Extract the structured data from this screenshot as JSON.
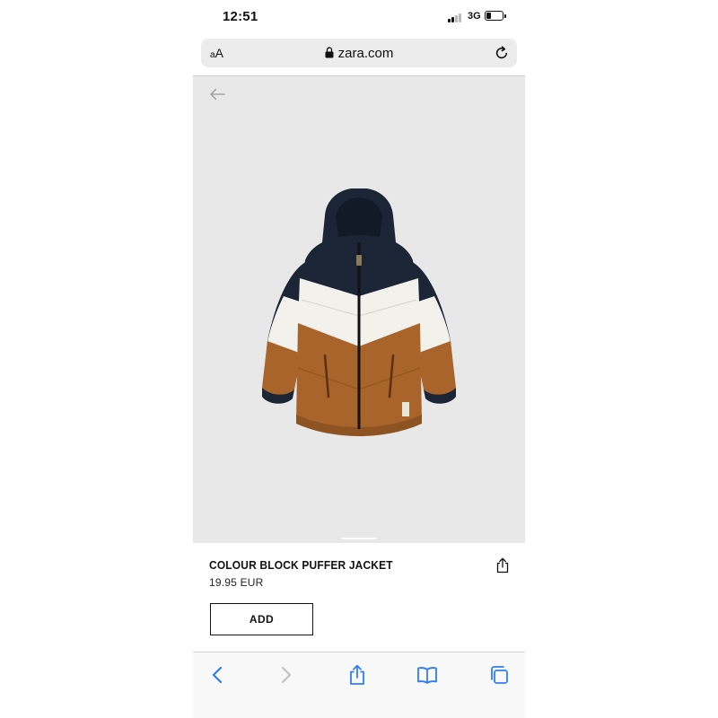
{
  "status_bar": {
    "time": "12:51",
    "network": "3G",
    "battery_level": 0.3
  },
  "browser": {
    "reader_label": "AA",
    "url": "zara.com",
    "icons": [
      "lock-icon",
      "reload-icon"
    ]
  },
  "product": {
    "title": "COLOUR BLOCK PUFFER JACKET",
    "price": "19.95 EUR",
    "add_label": "ADD",
    "colors": {
      "navy": "#1c2536",
      "white": "#f2f1ec",
      "camel": "#a8642b",
      "background": "#e8e8e9"
    }
  },
  "toolbar": {
    "icons": [
      "back-icon",
      "forward-icon",
      "share-icon",
      "bookmarks-icon",
      "tabs-icon"
    ],
    "accent": "#2f7cf6"
  }
}
